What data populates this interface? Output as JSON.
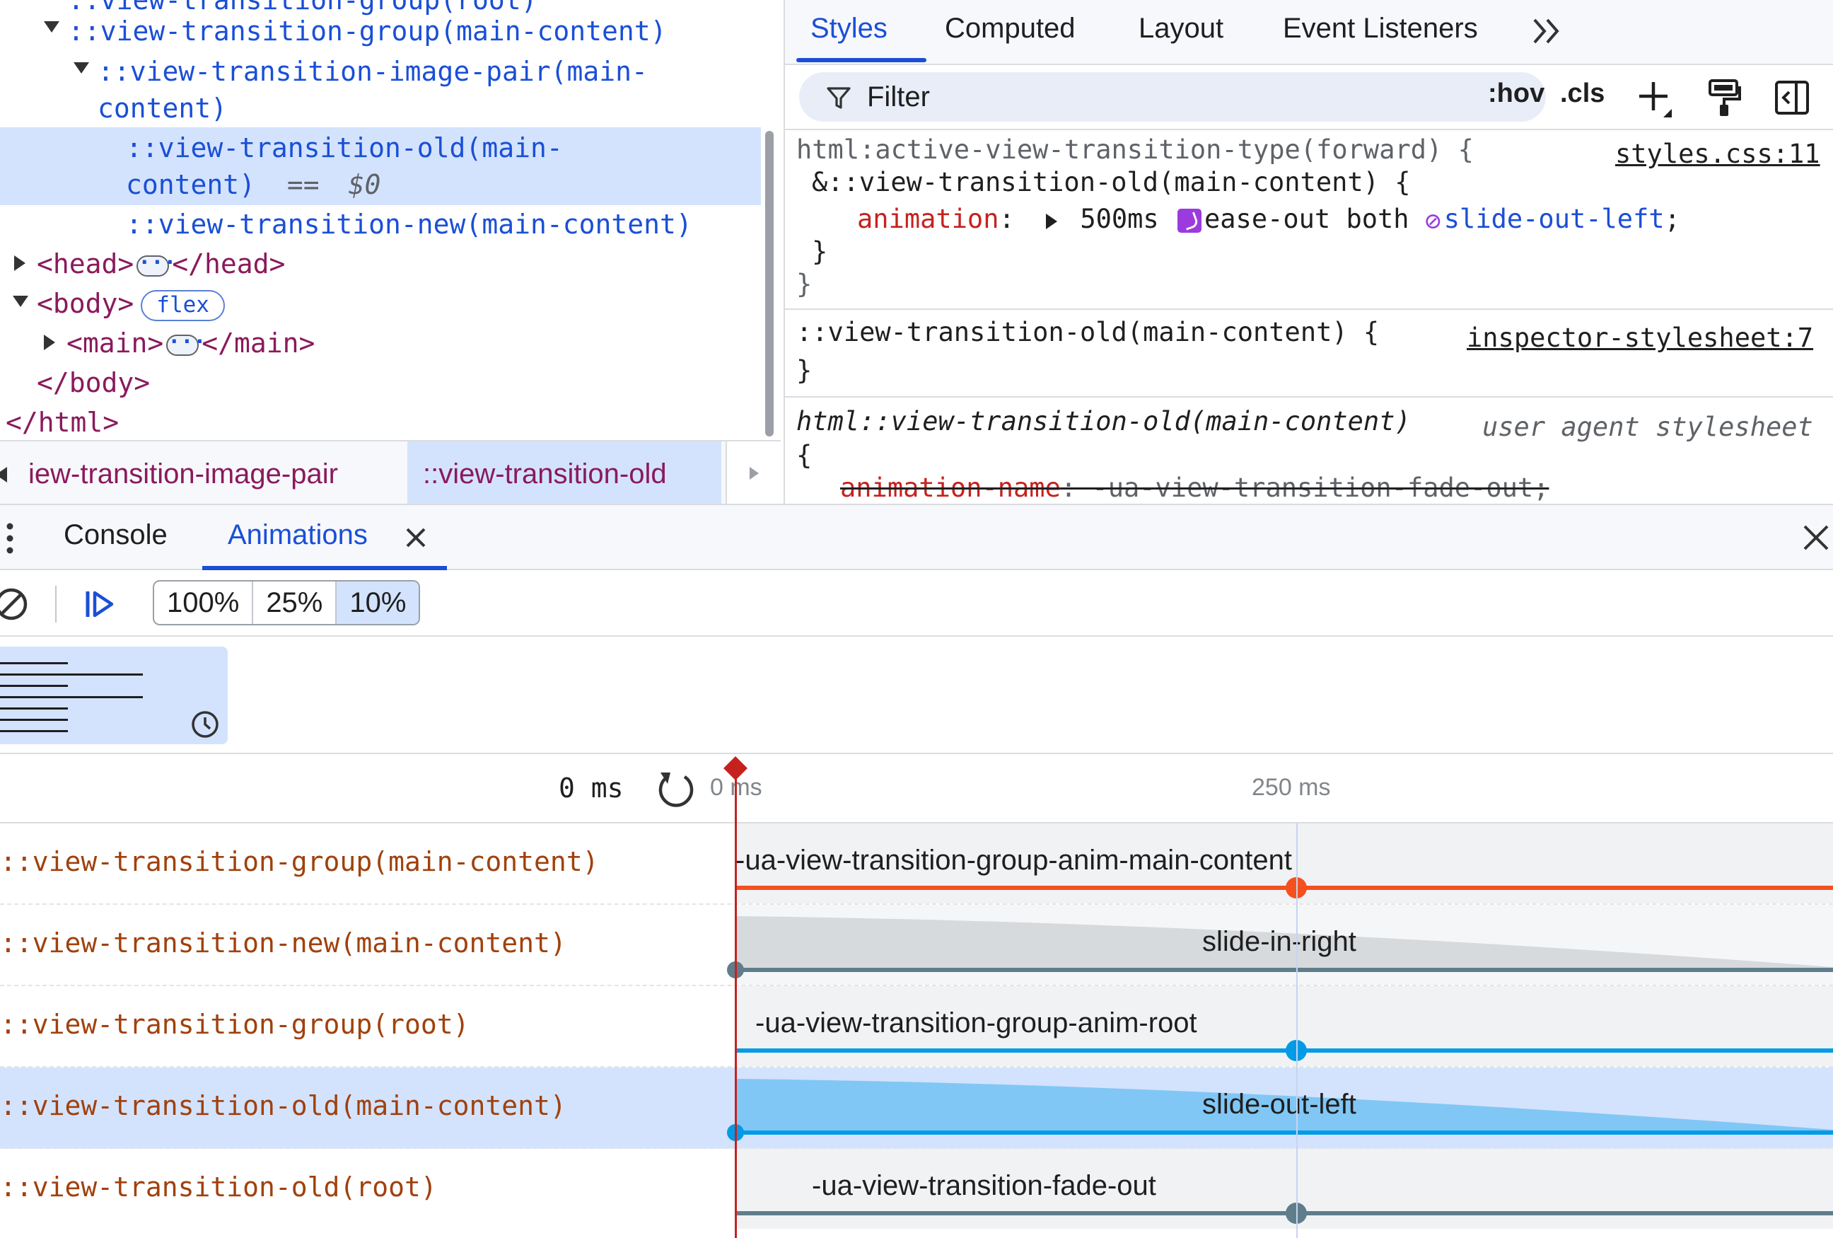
{
  "elements": {
    "lines": [
      "::view-transition-group(root)",
      "::view-transition-group(main-content)",
      "::view-transition-image-pair(main-",
      "content)",
      "::view-transition-old(main-",
      "content)",
      "==",
      "$0",
      "::view-transition-new(main-content)",
      "<head>",
      "</head>",
      "<body>",
      "flex",
      "<main>",
      "</main>",
      "</body>",
      "</html>"
    ]
  },
  "breadcrumb": {
    "items": [
      "iew-transition-image-pair",
      "::view-transition-old"
    ]
  },
  "styles": {
    "tabs": [
      "Styles",
      "Computed",
      "Layout",
      "Event Listeners"
    ],
    "filter_placeholder": "Filter",
    "hov": ":hov",
    "cls": ".cls",
    "rules": {
      "r1_selector": "html:active-view-transition-type(forward) {",
      "r1_source": "styles.css:11",
      "r1_nested": "&::view-transition-old(main-content) {",
      "r1_prop": "animation",
      "r1_colon": ":",
      "r1_duration": "500ms",
      "r1_easing": "ease-out both",
      "r1_name": "slide-out-left",
      "r1_semi": ";",
      "r1_close_inner": "}",
      "r1_close_outer": "}",
      "r2_selector": "::view-transition-old(main-content) {",
      "r2_source": "inspector-stylesheet:7",
      "r2_close": "}",
      "r3_selector": "html::view-transition-old(main-content)",
      "r3_source": "user agent stylesheet",
      "r3_open": "{",
      "r3_prop": "animation-name",
      "r3_value": ": -ua-view-transition-fade-out;"
    }
  },
  "drawer": {
    "tabs": [
      "Console",
      "Animations"
    ],
    "speeds": [
      "100%",
      "25%",
      "10%"
    ],
    "selected_speed": "10%"
  },
  "timeline": {
    "start_label": "0 ms",
    "ticks": [
      "0 ms",
      "250 ms"
    ],
    "rows": [
      {
        "label": "::view-transition-group(main-content)",
        "name": "-ua-view-transition-group-anim-main-content",
        "color": "#f4511e"
      },
      {
        "label": "::view-transition-new(main-content)",
        "name": "slide-in-right",
        "color": "#607d8b"
      },
      {
        "label": "::view-transition-group(root)",
        "name": "-ua-view-transition-group-anim-root",
        "color": "#039be5"
      },
      {
        "label": "::view-transition-old(main-content)",
        "name": "slide-out-left",
        "color": "#039be5"
      },
      {
        "label": "::view-transition-old(root)",
        "name": "-ua-view-transition-fade-out",
        "color": "#607d8b"
      }
    ]
  },
  "colors": {
    "accent": "#1a4fd6",
    "selection": "#d3e3fd",
    "playhead": "#c5221f"
  }
}
